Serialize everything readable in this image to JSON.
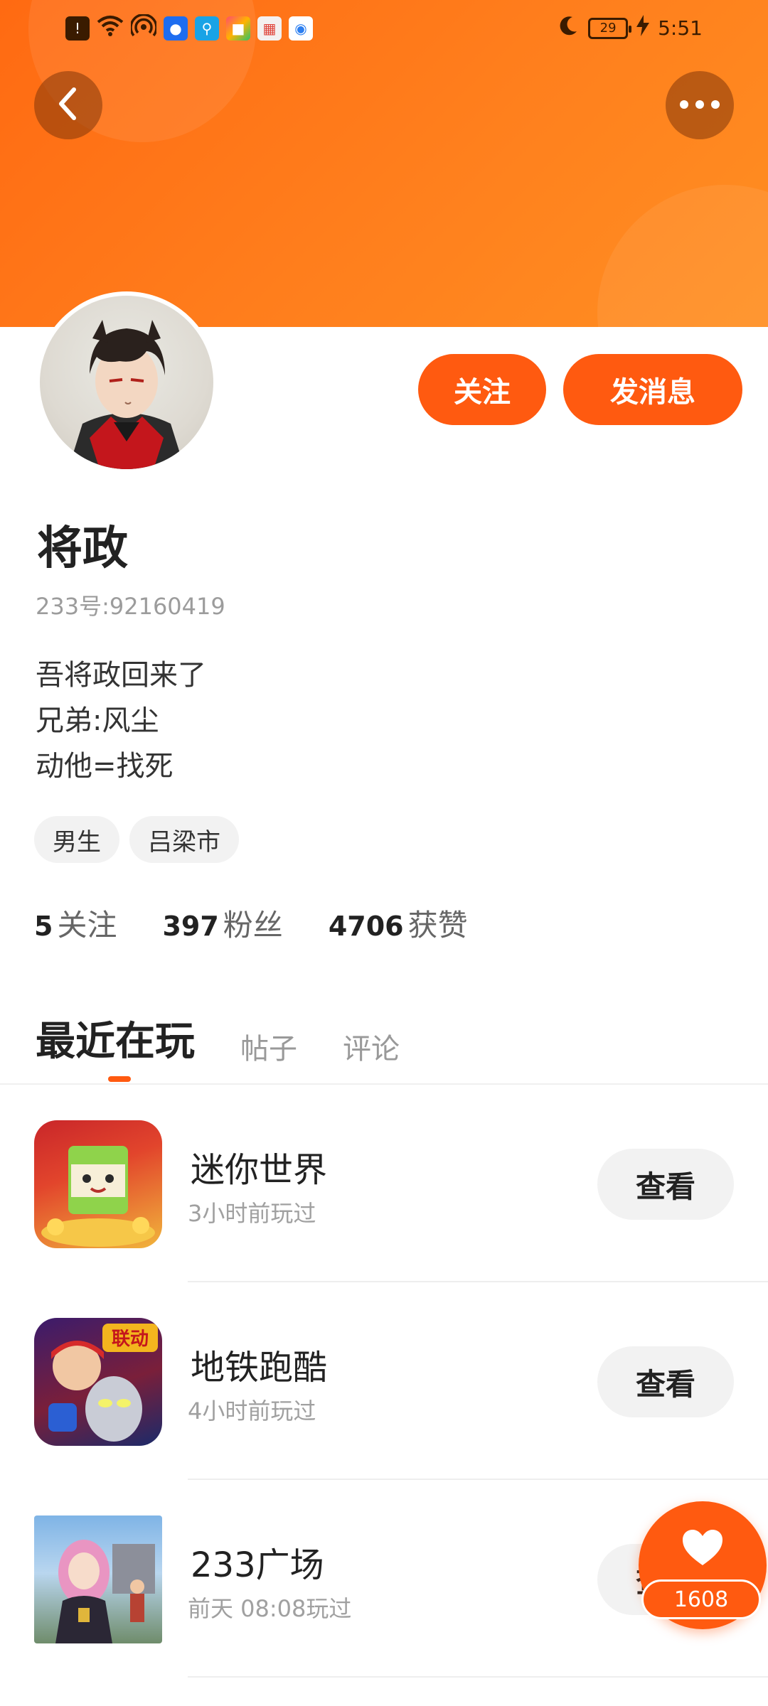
{
  "status_bar": {
    "time": "5:51",
    "battery": "29",
    "icons": [
      "alert-icon",
      "wifi-icon",
      "hotspot-icon",
      "app-bulb-icon",
      "app-search-icon",
      "app-brush-icon",
      "app-calendar-icon",
      "app-browser-icon",
      "moon-icon",
      "charging-icon"
    ]
  },
  "header": {
    "back_icon": "chevron-left-icon",
    "more_icon": "more-dots-icon"
  },
  "actions": {
    "follow_label": "关注",
    "message_label": "发消息"
  },
  "profile": {
    "name": "将政",
    "uid_text": "233号:92160419",
    "bio_lines": [
      "吾将政回来了",
      "兄弟:风尘",
      "动他=找死"
    ],
    "tags": [
      "男生",
      "吕梁市"
    ],
    "stats": [
      {
        "num": "5",
        "label": "关注"
      },
      {
        "num": "397",
        "label": "粉丝"
      },
      {
        "num": "4706",
        "label": "获赞"
      }
    ]
  },
  "tabs": [
    "最近在玩",
    "帖子",
    "评论"
  ],
  "games": [
    {
      "title": "迷你世界",
      "subtitle": "3小时前玩过",
      "button": "查看"
    },
    {
      "title": "地铁跑酷",
      "subtitle": "4小时前玩过",
      "button": "查看",
      "badge": "联动"
    },
    {
      "title": "233广场",
      "subtitle": "前天 08:08玩过",
      "button": "查看"
    }
  ],
  "like": {
    "count": "1608",
    "icon": "heart-icon"
  },
  "colors": {
    "accent": "#ff5a10",
    "header_from": "#ff6a12",
    "header_to": "#ff8f22"
  }
}
